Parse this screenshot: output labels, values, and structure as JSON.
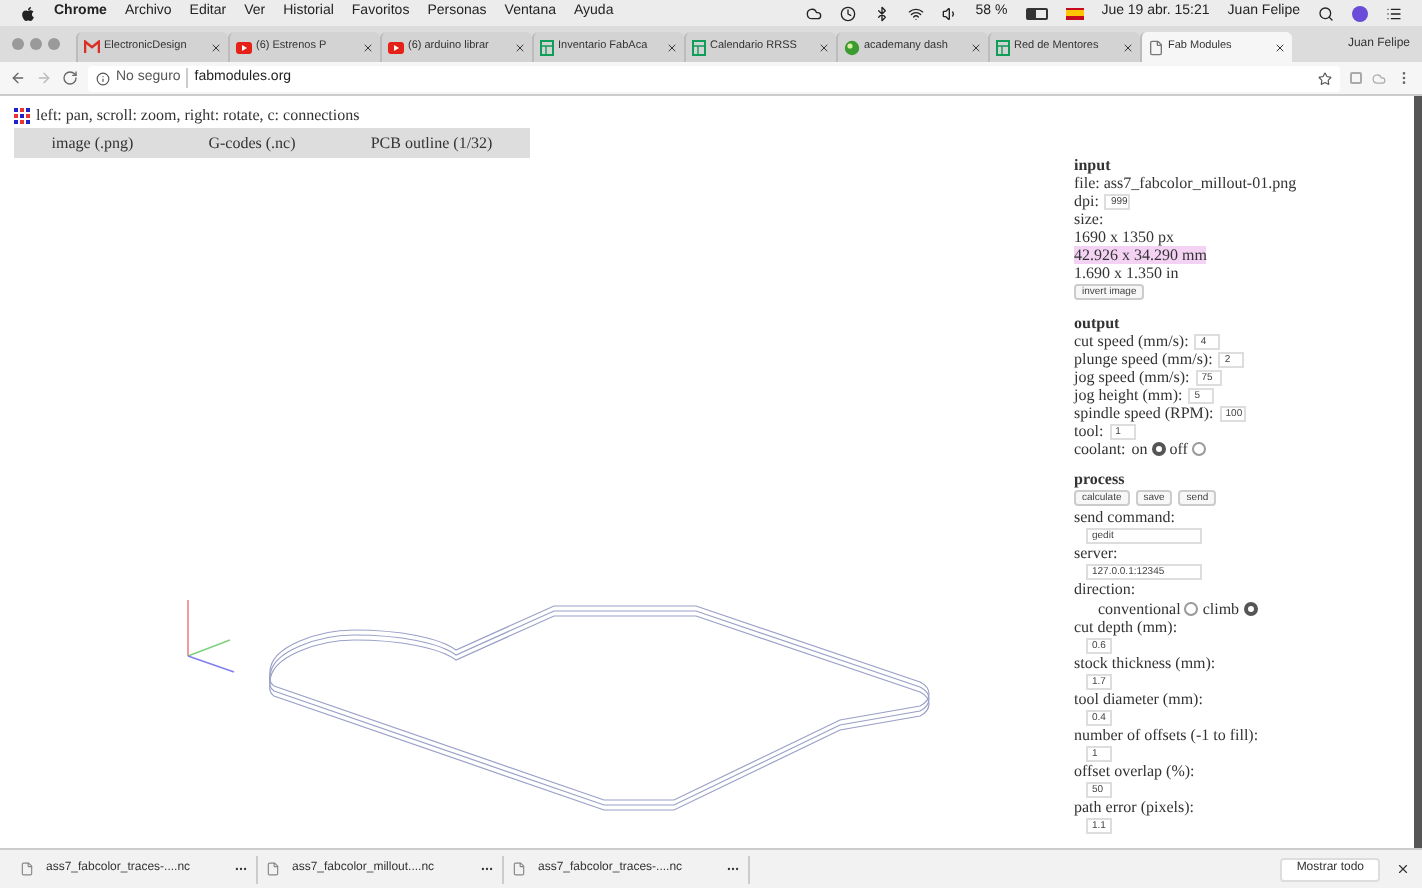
{
  "menu_bar": {
    "app": "Chrome",
    "items": [
      "Archivo",
      "Editar",
      "Ver",
      "Historial",
      "Favoritos",
      "Personas",
      "Ventana",
      "Ayuda"
    ],
    "battery": "58 %",
    "clock": "Jue 19 abr. 15:21",
    "user": "Juan Felipe"
  },
  "tabs": [
    {
      "title": "ElectronicDesign",
      "selected": false
    },
    {
      "title": "(6) Estrenos P",
      "selected": false
    },
    {
      "title": "(6) arduino librar",
      "selected": false
    },
    {
      "title": "Inventario FabAca",
      "selected": false
    },
    {
      "title": "Calendario RRSS",
      "selected": false
    },
    {
      "title": "academany dash",
      "selected": false
    },
    {
      "title": "Red de Mentores",
      "selected": false
    },
    {
      "title": "Fab Modules",
      "selected": true
    }
  ],
  "profile": "Juan Felipe",
  "address_bar": {
    "security": "No seguro",
    "url": "fabmodules.org"
  },
  "hint": "left: pan, scroll: zoom, right: rotate, c: connections",
  "modules_menu": [
    "image (.png)",
    "G-codes (.nc)",
    "PCB outline (1/32)"
  ],
  "panel": [
    {
      "heading": "input",
      "rows": [
        {
          "kind": "text",
          "text": "file: ass7_fabcolor_millout-01.png",
          "highlighted": false
        },
        {
          "kind": "inline_field",
          "label": "dpi:",
          "value": "999"
        },
        {
          "kind": "text",
          "text": "size:",
          "highlighted": false
        },
        {
          "kind": "text",
          "text": "1690 x 1350 px",
          "highlighted": false
        },
        {
          "kind": "text",
          "text": "42.926 x 34.290 mm",
          "highlighted": true
        },
        {
          "kind": "text",
          "text": "1.690 x 1.350 in",
          "highlighted": false
        },
        {
          "kind": "buttons",
          "labels": [
            "invert image"
          ]
        }
      ]
    },
    {
      "heading": "output",
      "rows": [
        {
          "kind": "inline_field",
          "label": "cut speed (mm/s):",
          "value": "4"
        },
        {
          "kind": "inline_field",
          "label": "plunge speed (mm/s):",
          "value": "2"
        },
        {
          "kind": "inline_field",
          "label": "jog speed (mm/s):",
          "value": "75"
        },
        {
          "kind": "inline_field",
          "label": "jog height (mm):",
          "value": "5"
        },
        {
          "kind": "inline_field",
          "label": "spindle speed (RPM):",
          "value": "100"
        },
        {
          "kind": "inline_field",
          "label": "tool:",
          "value": "1"
        },
        {
          "kind": "radio",
          "label": "coolant:",
          "options": [
            {
              "label": "on",
              "selected": true
            },
            {
              "label": "off",
              "selected": false
            }
          ]
        }
      ]
    },
    {
      "heading": "process",
      "rows": [
        {
          "kind": "buttons",
          "labels": [
            "calculate",
            "save",
            "send"
          ]
        },
        {
          "kind": "block_field",
          "label": "send command:",
          "value": "gedit"
        },
        {
          "kind": "block_field",
          "label": "server:",
          "value": "127.0.0.1:12345"
        },
        {
          "kind": "radio_block",
          "label": "direction:",
          "options": [
            {
              "label": "conventional",
              "selected": false
            },
            {
              "label": "climb",
              "selected": true
            }
          ]
        },
        {
          "kind": "block_field",
          "label": "cut depth (mm):",
          "value": "0.6"
        },
        {
          "kind": "block_field",
          "label": "stock thickness (mm):",
          "value": "1.7"
        },
        {
          "kind": "block_field",
          "label": "tool diameter (mm):",
          "value": "0.4"
        },
        {
          "kind": "block_field",
          "label": "number of offsets (-1 to fill):",
          "value": "1"
        },
        {
          "kind": "block_field",
          "label": "offset overlap (%):",
          "value": "50"
        },
        {
          "kind": "block_field",
          "label": "path error (pixels):",
          "value": "1.1"
        }
      ]
    }
  ],
  "downloads": {
    "items": [
      "ass7_fabcolor_traces-....nc",
      "ass7_fabcolor_millout....nc",
      "ass7_fabcolor_traces-....nc"
    ],
    "show_all": "Mostrar todo"
  }
}
